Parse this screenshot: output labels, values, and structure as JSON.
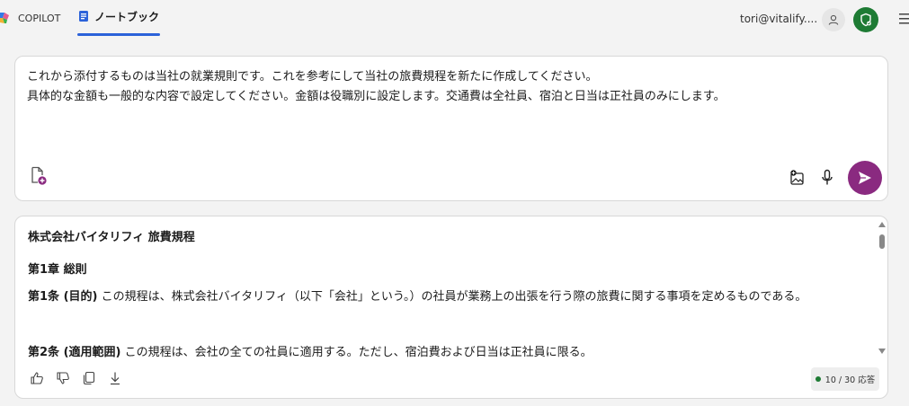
{
  "tabs": [
    {
      "label": "COPILOT",
      "active": false
    },
    {
      "label": "ノートブック",
      "active": true
    }
  ],
  "user": {
    "email": "tori@vitalify...."
  },
  "prompt": {
    "text": "これから添付するものは当社の就業規則です。これを参考にして当社の旅費規程を新たに作成してください。\n具体的な金額も一般的な内容で設定してください。金額は役職別に設定します。交通費は全社員、宿泊と日当は正社員のみにします。"
  },
  "response": {
    "title": "株式会社バイタリフィ 旅費規程",
    "chapter": "第1章 総則",
    "articles": [
      {
        "label": "第1条 (目的)",
        "text": " この規程は、株式会社バイタリフィ（以下「会社」という。）の社員が業務上の出張を行う際の旅費に関する事項を定めるものである。"
      },
      {
        "label": "第2条 (適用範囲)",
        "text": " この規程は、会社の全ての社員に適用する。ただし、宿泊費および日当は正社員に限る。"
      }
    ]
  },
  "response_counter": "10 / 30 応答",
  "icons": {
    "attach": "add-file-icon",
    "image": "add-image-icon",
    "mic": "microphone-icon",
    "send": "send-icon",
    "like": "thumbs-up-icon",
    "dislike": "thumbs-down-icon",
    "copy": "copy-icon",
    "download": "download-icon"
  },
  "colors": {
    "accent_tab": "#2b62d9",
    "send_button": "#8a2a80",
    "avatar_green": "#1e7b34"
  }
}
